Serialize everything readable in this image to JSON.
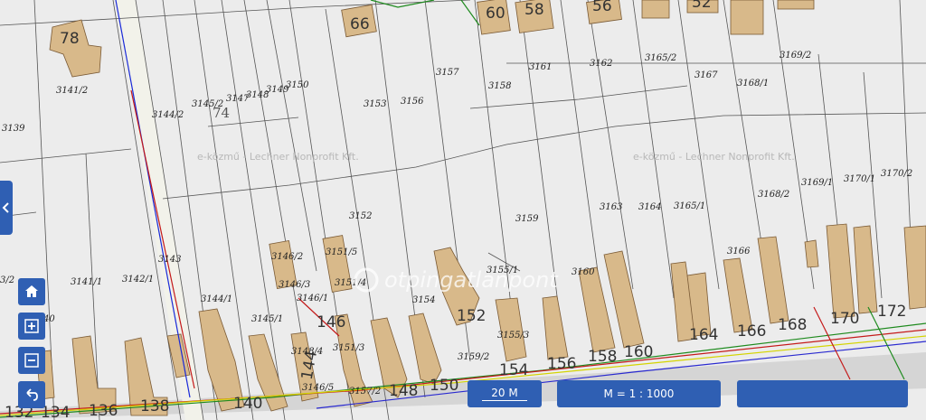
{
  "map": {
    "watermark_text": "e-közmű - Lechner Nonprofit Kft.",
    "logo_watermark": "otpingatlanpont",
    "house_numbers": [
      "78",
      "66",
      "60",
      "58",
      "56",
      "52",
      "146",
      "152",
      "154",
      "156",
      "158",
      "160",
      "164",
      "166",
      "168",
      "170",
      "172",
      "148",
      "150",
      "144",
      "140",
      "138",
      "136",
      "134",
      "132"
    ],
    "parcel_labels": [
      "3141/2",
      "3139",
      "3144/2",
      "3145/2",
      "3147",
      "3148",
      "3149",
      "3150",
      "3153",
      "3156",
      "3157",
      "3158",
      "3161",
      "3162",
      "3165/2",
      "3167",
      "3168/1",
      "3169/2",
      "3152",
      "3159",
      "3163",
      "3164",
      "3165/1",
      "3168/2",
      "3169/1",
      "3170/1",
      "3170/2",
      "3166",
      "3160",
      "3155/1",
      "3154",
      "3155/3",
      "3159/2",
      "3146/2",
      "3146/3",
      "3146/1",
      "3151/5",
      "3151/4",
      "3151/3",
      "3148/4",
      "3146/5",
      "3157/2",
      "3143",
      "3144/1",
      "3145/1",
      "3141/1",
      "3142/1",
      "3/2",
      "40",
      "74"
    ],
    "colors": {
      "background": "#ececec",
      "building": "#d8b98a",
      "panel": "#2f5fb3"
    }
  },
  "controls": {
    "home": "home-icon",
    "zoom_in": "zoom-in-icon",
    "zoom_out": "zoom-out-icon",
    "back": "back-icon",
    "side_panel": "chevron-left-icon"
  },
  "footer": {
    "scale_bar": "20 M",
    "scale_ratio": "M = 1 : 1000",
    "third_box": ""
  }
}
